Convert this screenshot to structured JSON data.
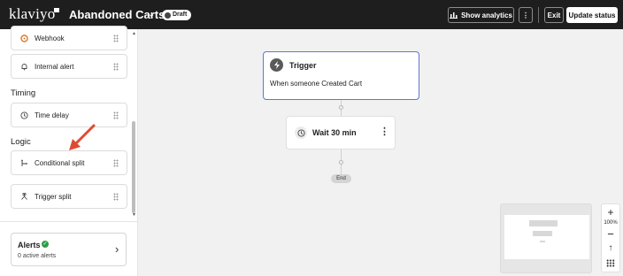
{
  "header": {
    "logo": "klaviyo",
    "title": "Abandoned Carts",
    "title_chevron": "⌄",
    "status": "Draft",
    "analytics_label": "Show analytics",
    "more_label": "⋮",
    "exit_label": "Exit",
    "update_label": "Update status"
  },
  "sidebar": {
    "items_top": [
      {
        "label": "Webhook",
        "icon": "webhook-icon"
      },
      {
        "label": "Internal alert",
        "icon": "bell-icon"
      }
    ],
    "timing_heading": "Timing",
    "timing_items": [
      {
        "label": "Time delay",
        "icon": "clock-icon"
      }
    ],
    "logic_heading": "Logic",
    "logic_items": [
      {
        "label": "Conditional split",
        "icon": "split-icon"
      },
      {
        "label": "Trigger split",
        "icon": "trigger-split-icon"
      }
    ],
    "alerts": {
      "title": "Alerts",
      "subtitle": "0 active alerts",
      "status_color": "#2e9d4b"
    }
  },
  "canvas": {
    "trigger": {
      "title": "Trigger",
      "description": "When someone Created Cart",
      "icon": "lightning-icon"
    },
    "wait": {
      "title": "Wait 30 min",
      "icon": "clock-icon",
      "menu": "⋮"
    },
    "end_label": "End"
  },
  "zoom": {
    "plus": "+",
    "level": "100%",
    "minus": "−",
    "up": "↑"
  },
  "colors": {
    "topbar": "#1e1e1e",
    "accent_border": "#5e76d4",
    "annotation_arrow": "#e04a32"
  }
}
